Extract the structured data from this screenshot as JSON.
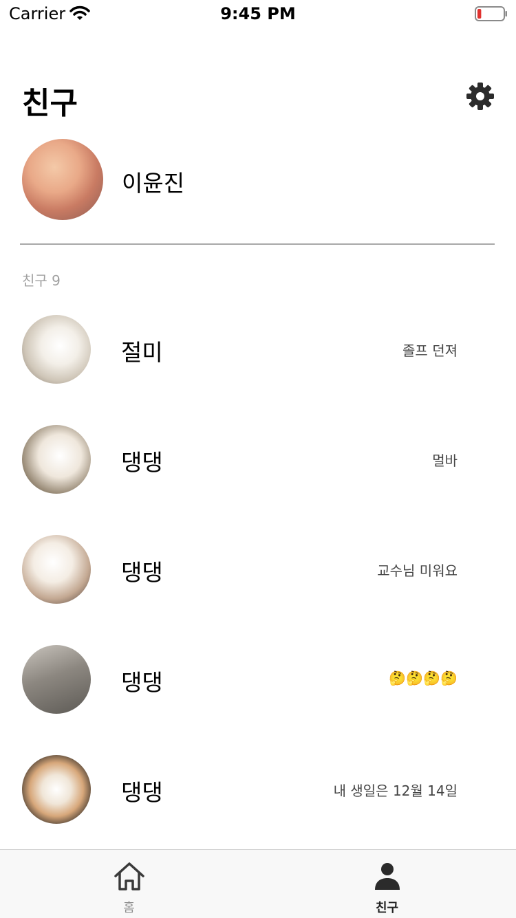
{
  "status_bar": {
    "carrier": "Carrier",
    "time": "9:45 PM",
    "battery_level": 0.15
  },
  "header": {
    "title": "친구",
    "settings_icon": "gear-icon"
  },
  "profile": {
    "name": "이윤진"
  },
  "friends_section": {
    "label": "친구",
    "count": "9"
  },
  "friends": [
    {
      "name": "절미",
      "status": "졸프 던져"
    },
    {
      "name": "댕댕",
      "status": "멀바"
    },
    {
      "name": "댕댕",
      "status": "교수님 미워요"
    },
    {
      "name": "댕댕",
      "status": "🤔🤔🤔🤔"
    },
    {
      "name": "댕댕",
      "status": "내 생일은 12월 14일"
    }
  ],
  "tab_bar": {
    "home_label": "홈",
    "friends_label": "친구",
    "selected": "friends"
  },
  "colors": {
    "tab_active": "#222222",
    "tab_inactive": "#8e8e8e",
    "divider": "#a8a8a8",
    "battery_low": "#e0322f"
  }
}
